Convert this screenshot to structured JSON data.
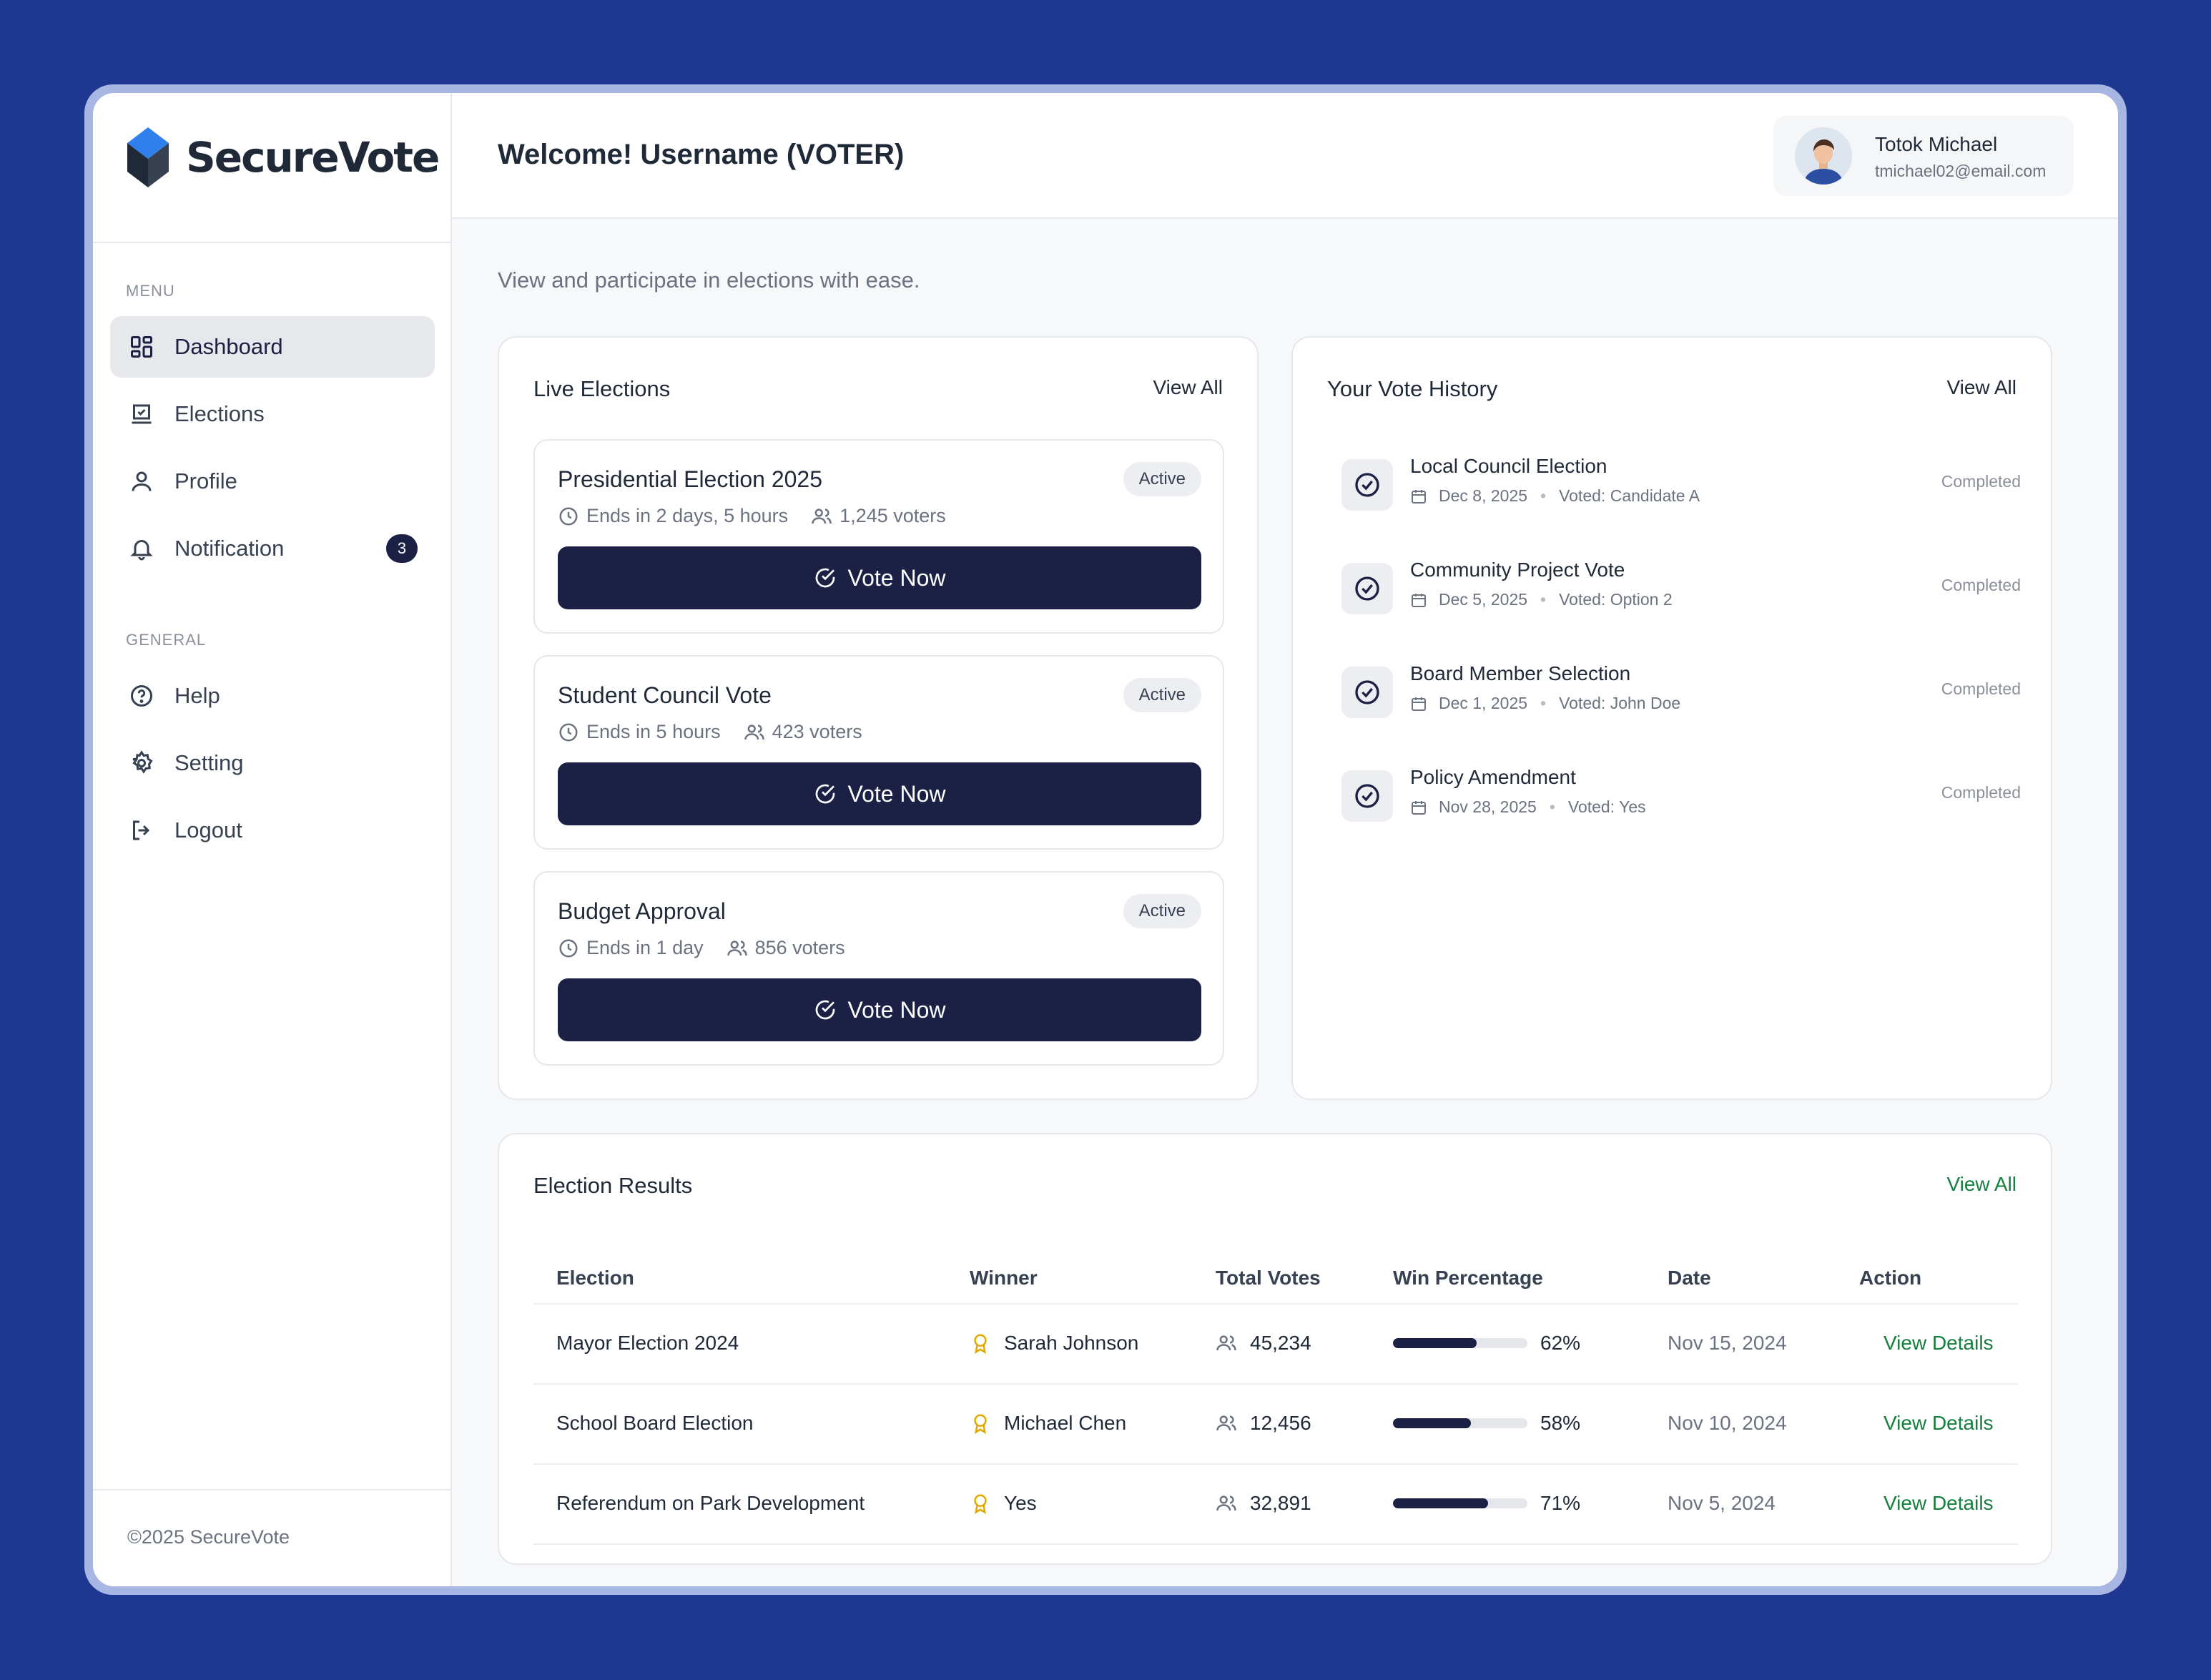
{
  "brand": {
    "name": "SecureVote",
    "copyright": "©2025 SecureVote"
  },
  "sidebar": {
    "menu_label": "MENU",
    "general_label": "GENERAL",
    "menu": [
      {
        "label": "Dashboard",
        "icon": "dashboard-icon",
        "active": true
      },
      {
        "label": "Elections",
        "icon": "ballot-icon"
      },
      {
        "label": "Profile",
        "icon": "user-icon"
      },
      {
        "label": "Notification",
        "icon": "bell-icon",
        "badge": "3"
      }
    ],
    "general": [
      {
        "label": "Help",
        "icon": "help-icon"
      },
      {
        "label": "Setting",
        "icon": "gear-icon"
      },
      {
        "label": "Logout",
        "icon": "logout-icon"
      }
    ]
  },
  "header": {
    "welcome": "Welcome! Username (VOTER)",
    "user_name": "Totok Michael",
    "user_email": "tmichael02@email.com"
  },
  "subtitle": "View and participate in elections with ease.",
  "live_elections": {
    "title": "Live Elections",
    "view_all": "View All",
    "items": [
      {
        "name": "Presidential Election 2025",
        "status": "Active",
        "ends": "Ends in 2 days, 5 hours",
        "voters": "1,245 voters",
        "button": "Vote Now"
      },
      {
        "name": "Student Council Vote",
        "status": "Active",
        "ends": "Ends in 5 hours",
        "voters": "423 voters",
        "button": "Vote Now"
      },
      {
        "name": "Budget Approval",
        "status": "Active",
        "ends": "Ends in 1 day",
        "voters": "856 voters",
        "button": "Vote Now"
      }
    ]
  },
  "vote_history": {
    "title": "Your Vote History",
    "view_all": "View All",
    "items": [
      {
        "title": "Local Council Election",
        "date": "Dec 8, 2025",
        "voted": "Voted: Candidate A",
        "status": "Completed"
      },
      {
        "title": "Community Project Vote",
        "date": "Dec 5, 2025",
        "voted": "Voted: Option 2",
        "status": "Completed"
      },
      {
        "title": "Board Member Selection",
        "date": "Dec 1, 2025",
        "voted": "Voted: John Doe",
        "status": "Completed"
      },
      {
        "title": "Policy Amendment",
        "date": "Nov 28, 2025",
        "voted": "Voted: Yes",
        "status": "Completed"
      }
    ]
  },
  "results": {
    "title": "Election Results",
    "view_all": "View All",
    "columns": [
      "Election",
      "Winner",
      "Total Votes",
      "Win Percentage",
      "Date",
      "Action"
    ],
    "rows": [
      {
        "election": "Mayor Election 2024",
        "winner": "Sarah Johnson",
        "total_votes": "45,234",
        "win_pct": 62,
        "win_pct_label": "62%",
        "date": "Nov 15, 2024",
        "action": "View Details"
      },
      {
        "election": "School Board Election",
        "winner": "Michael Chen",
        "total_votes": "12,456",
        "win_pct": 58,
        "win_pct_label": "58%",
        "date": "Nov 10, 2024",
        "action": "View Details"
      },
      {
        "election": "Referendum on Park Development",
        "winner": "Yes",
        "total_votes": "32,891",
        "win_pct": 71,
        "win_pct_label": "71%",
        "date": "Nov 5, 2024",
        "action": "View Details"
      }
    ]
  },
  "colors": {
    "background": "#1e3790",
    "primary": "#1c2045",
    "link": "#15803d",
    "logo_blue": "#2f80ed",
    "winner_icon": "#e0a800"
  }
}
